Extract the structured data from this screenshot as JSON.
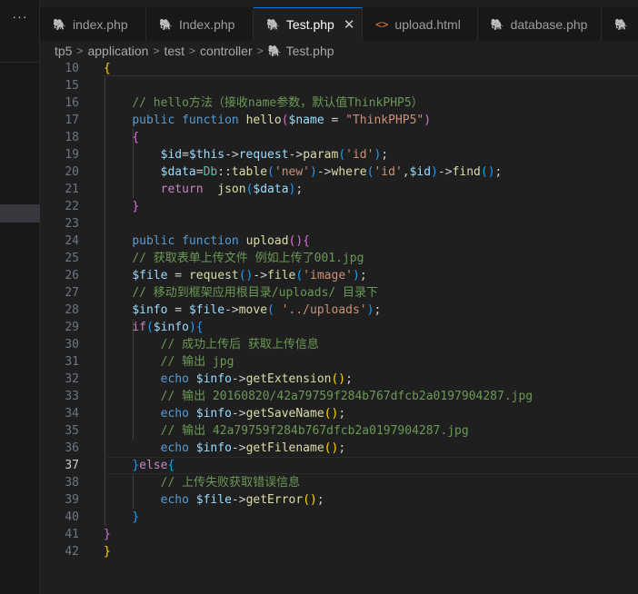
{
  "sidebar": {
    "more_label": "···"
  },
  "tabs": [
    {
      "label": "index.php",
      "icon": "php-elephant-icon",
      "active": false
    },
    {
      "label": "Index.php",
      "icon": "php-elephant-icon",
      "active": false
    },
    {
      "label": "Test.php",
      "icon": "php-elephant-icon",
      "active": true,
      "close": "✕"
    },
    {
      "label": "upload.html",
      "icon": "html-code-icon",
      "active": false
    },
    {
      "label": "database.php",
      "icon": "php-elephant-icon",
      "active": false
    },
    {
      "label": "",
      "icon": "php-elephant-icon",
      "active": false
    }
  ],
  "breadcrumb": [
    "tp5",
    "application",
    "test",
    "controller",
    "Test.php"
  ],
  "editor": {
    "current_line": 37,
    "lines": [
      {
        "n": 10,
        "tokens": [
          [
            "b1",
            "{"
          ]
        ]
      },
      {
        "n": 15,
        "tokens": []
      },
      {
        "n": 16,
        "tokens": [
          [
            "",
            "    "
          ],
          [
            "cm",
            "// hello方法（接收name参数，默认值ThinkPHP5）"
          ]
        ]
      },
      {
        "n": 17,
        "tokens": [
          [
            "",
            "    "
          ],
          [
            "kw",
            "public"
          ],
          [
            "",
            " "
          ],
          [
            "kw",
            "function"
          ],
          [
            "",
            " "
          ],
          [
            "fn",
            "hello"
          ],
          [
            "b2",
            "("
          ],
          [
            "var",
            "$name"
          ],
          [
            "",
            " = "
          ],
          [
            "str",
            "\"ThinkPHP5\""
          ],
          [
            "b2",
            ")"
          ]
        ]
      },
      {
        "n": 18,
        "tokens": [
          [
            "",
            "    "
          ],
          [
            "b2",
            "{"
          ]
        ]
      },
      {
        "n": 19,
        "tokens": [
          [
            "",
            "        "
          ],
          [
            "var",
            "$id"
          ],
          [
            "",
            "="
          ],
          [
            "var",
            "$this"
          ],
          [
            "",
            "->"
          ],
          [
            "var",
            "request"
          ],
          [
            "",
            "->"
          ],
          [
            "fn",
            "param"
          ],
          [
            "b3",
            "("
          ],
          [
            "str",
            "'id'"
          ],
          [
            "b3",
            ")"
          ],
          [
            "",
            ";"
          ]
        ]
      },
      {
        "n": 20,
        "tokens": [
          [
            "",
            "        "
          ],
          [
            "var",
            "$data"
          ],
          [
            "",
            "="
          ],
          [
            "cls",
            "Db"
          ],
          [
            "",
            "::"
          ],
          [
            "fn",
            "table"
          ],
          [
            "b3",
            "("
          ],
          [
            "str",
            "'new'"
          ],
          [
            "b3",
            ")"
          ],
          [
            "",
            "->"
          ],
          [
            "fn",
            "where"
          ],
          [
            "b3",
            "("
          ],
          [
            "str",
            "'id'"
          ],
          [
            "",
            ","
          ],
          [
            "var",
            "$id"
          ],
          [
            "b3",
            ")"
          ],
          [
            "",
            "->"
          ],
          [
            "fn",
            "find"
          ],
          [
            "b3",
            "()"
          ],
          [
            "",
            ";"
          ]
        ]
      },
      {
        "n": 21,
        "tokens": [
          [
            "",
            "        "
          ],
          [
            "ctl",
            "return"
          ],
          [
            "",
            "  "
          ],
          [
            "fn",
            "json"
          ],
          [
            "b3",
            "("
          ],
          [
            "var",
            "$data"
          ],
          [
            "b3",
            ")"
          ],
          [
            "",
            ";"
          ]
        ]
      },
      {
        "n": 22,
        "tokens": [
          [
            "",
            "    "
          ],
          [
            "b2",
            "}"
          ]
        ]
      },
      {
        "n": 23,
        "tokens": []
      },
      {
        "n": 24,
        "tokens": [
          [
            "",
            "    "
          ],
          [
            "kw",
            "public"
          ],
          [
            "",
            " "
          ],
          [
            "kw",
            "function"
          ],
          [
            "",
            " "
          ],
          [
            "fn",
            "upload"
          ],
          [
            "b2",
            "(){"
          ]
        ]
      },
      {
        "n": 25,
        "tokens": [
          [
            "",
            "    "
          ],
          [
            "cm",
            "// 获取表单上传文件 例如上传了001.jpg"
          ]
        ]
      },
      {
        "n": 26,
        "tokens": [
          [
            "",
            "    "
          ],
          [
            "var",
            "$file"
          ],
          [
            "",
            " = "
          ],
          [
            "fn",
            "request"
          ],
          [
            "b3",
            "()"
          ],
          [
            "",
            "->"
          ],
          [
            "fn",
            "file"
          ],
          [
            "b3",
            "("
          ],
          [
            "str",
            "'image'"
          ],
          [
            "b3",
            ")"
          ],
          [
            "",
            ";"
          ]
        ]
      },
      {
        "n": 27,
        "tokens": [
          [
            "",
            "    "
          ],
          [
            "cm",
            "// 移动到框架应用根目录/uploads/ 目录下"
          ]
        ]
      },
      {
        "n": 28,
        "tokens": [
          [
            "",
            "    "
          ],
          [
            "var",
            "$info"
          ],
          [
            "",
            " = "
          ],
          [
            "var",
            "$file"
          ],
          [
            "",
            "->"
          ],
          [
            "fn",
            "move"
          ],
          [
            "b3",
            "("
          ],
          [
            "",
            " "
          ],
          [
            "str",
            "'../uploads'"
          ],
          [
            "b3",
            ")"
          ],
          [
            "",
            ";"
          ]
        ]
      },
      {
        "n": 29,
        "tokens": [
          [
            "",
            "    "
          ],
          [
            "ctl",
            "if"
          ],
          [
            "b3",
            "("
          ],
          [
            "var",
            "$info"
          ],
          [
            "b3",
            ")"
          ],
          [
            "b3",
            "{"
          ]
        ]
      },
      {
        "n": 30,
        "tokens": [
          [
            "",
            "        "
          ],
          [
            "cm",
            "// 成功上传后 获取上传信息"
          ]
        ]
      },
      {
        "n": 31,
        "tokens": [
          [
            "",
            "        "
          ],
          [
            "cm",
            "// 输出 jpg"
          ]
        ]
      },
      {
        "n": 32,
        "tokens": [
          [
            "",
            "        "
          ],
          [
            "kw",
            "echo"
          ],
          [
            "",
            " "
          ],
          [
            "var",
            "$info"
          ],
          [
            "",
            "->"
          ],
          [
            "fn",
            "getExtension"
          ],
          [
            "b1",
            "()"
          ],
          [
            "",
            ";"
          ]
        ]
      },
      {
        "n": 33,
        "tokens": [
          [
            "",
            "        "
          ],
          [
            "cm",
            "// 输出 20160820/42a79759f284b767dfcb2a0197904287.jpg"
          ]
        ]
      },
      {
        "n": 34,
        "tokens": [
          [
            "",
            "        "
          ],
          [
            "kw",
            "echo"
          ],
          [
            "",
            " "
          ],
          [
            "var",
            "$info"
          ],
          [
            "",
            "->"
          ],
          [
            "fn",
            "getSaveName"
          ],
          [
            "b1",
            "()"
          ],
          [
            "",
            ";"
          ]
        ]
      },
      {
        "n": 35,
        "tokens": [
          [
            "",
            "        "
          ],
          [
            "cm",
            "// 输出 42a79759f284b767dfcb2a0197904287.jpg"
          ]
        ]
      },
      {
        "n": 36,
        "tokens": [
          [
            "",
            "        "
          ],
          [
            "kw",
            "echo"
          ],
          [
            "",
            " "
          ],
          [
            "var",
            "$info"
          ],
          [
            "",
            "->"
          ],
          [
            "fn",
            "getFilename"
          ],
          [
            "b1",
            "()"
          ],
          [
            "",
            ";"
          ]
        ]
      },
      {
        "n": 37,
        "tokens": [
          [
            "",
            "    "
          ],
          [
            "b3",
            "}"
          ],
          [
            "ctl",
            "else"
          ],
          [
            "b3",
            "{"
          ]
        ]
      },
      {
        "n": 38,
        "tokens": [
          [
            "",
            "        "
          ],
          [
            "cm",
            "// 上传失败获取错误信息"
          ]
        ]
      },
      {
        "n": 39,
        "tokens": [
          [
            "",
            "        "
          ],
          [
            "kw",
            "echo"
          ],
          [
            "",
            " "
          ],
          [
            "var",
            "$file"
          ],
          [
            "",
            "->"
          ],
          [
            "fn",
            "getError"
          ],
          [
            "b1",
            "()"
          ],
          [
            "",
            ";"
          ]
        ]
      },
      {
        "n": 40,
        "tokens": [
          [
            "",
            "    "
          ],
          [
            "b3",
            "}"
          ]
        ]
      },
      {
        "n": 41,
        "tokens": [
          [
            "b2",
            "}"
          ]
        ]
      },
      {
        "n": 42,
        "tokens": [
          [
            "b1",
            "}"
          ]
        ]
      }
    ]
  }
}
